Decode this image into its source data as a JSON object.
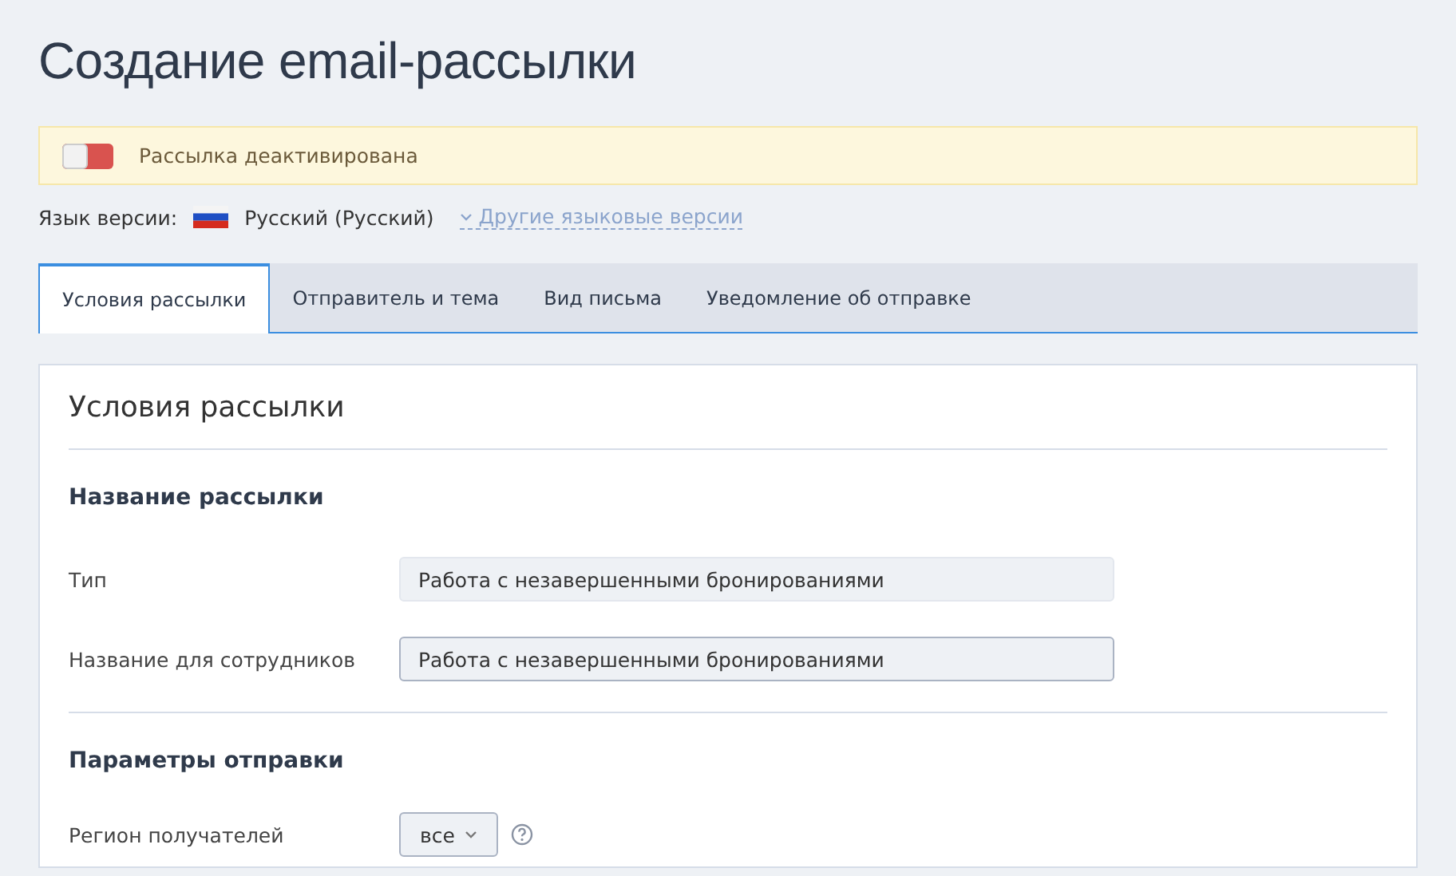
{
  "title": "Создание email-рассылки",
  "status_banner": {
    "on": false,
    "text": "Рассылка деактивирована"
  },
  "language": {
    "label": "Язык версии:",
    "current": "Русский (Русский)",
    "other_link": "Другие языковые версии"
  },
  "tabs": [
    {
      "label": "Условия рассылки",
      "selected": true
    },
    {
      "label": "Отправитель и тема",
      "selected": false
    },
    {
      "label": "Вид письма",
      "selected": false
    },
    {
      "label": "Уведомление об отправке",
      "selected": false
    }
  ],
  "card": {
    "title": "Условия рассылки",
    "sections": [
      {
        "heading": "Название рассылки",
        "fields": [
          {
            "kind": "readonly",
            "label": "Тип",
            "value": "Работа с незавершенными бронированиями"
          },
          {
            "kind": "input",
            "label": "Название для сотрудников",
            "value": "Работа с незавершенными бронированиями"
          }
        ]
      },
      {
        "heading": "Параметры отправки",
        "fields": [
          {
            "kind": "select",
            "label": "Регион получателей",
            "value": "все",
            "help": true
          }
        ]
      }
    ]
  }
}
